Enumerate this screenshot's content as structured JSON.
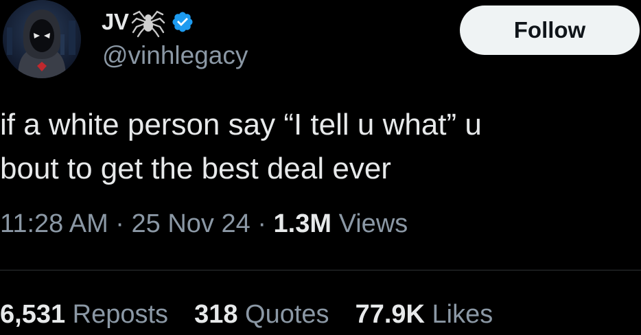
{
  "user": {
    "display_name": "JV",
    "handle": "@vinhlegacy",
    "badge_icon": "spider-icon",
    "verified_icon": "verified-badge-icon",
    "verified_color": "#1d9bf0"
  },
  "follow_button": {
    "label": "Follow"
  },
  "tweet": {
    "lines": [
      "if a white person say “I tell u what” u",
      "bout to get the best deal ever"
    ]
  },
  "meta": {
    "time": "11:28 AM",
    "separator": "·",
    "date": "25 Nov 24",
    "views_count": "1.3M",
    "views_label": "Views"
  },
  "stats": {
    "reposts_count": "6,531",
    "reposts_label": "Reposts",
    "quotes_count": "318",
    "quotes_label": "Quotes",
    "likes_count": "77.9K",
    "likes_label": "Likes"
  },
  "colors": {
    "background": "#000000",
    "text": "#e7e9ea",
    "secondary": "#8b98a5",
    "button_bg": "#eff3f4"
  }
}
